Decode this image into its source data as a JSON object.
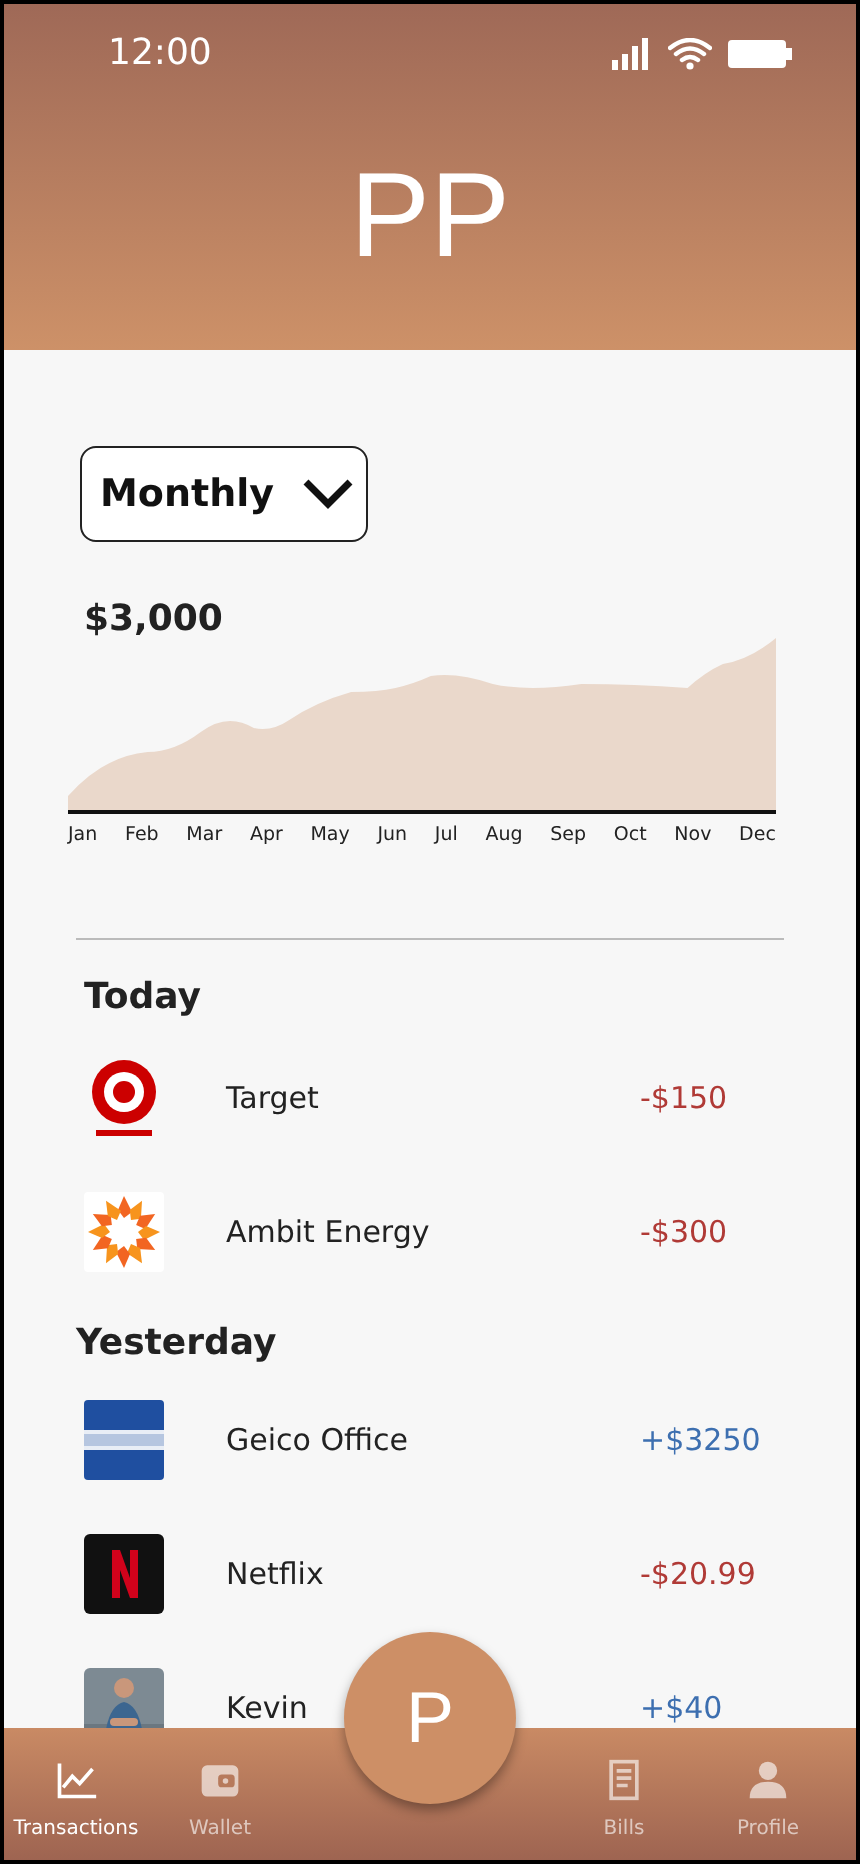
{
  "status_bar": {
    "time": "12:00"
  },
  "header": {
    "initials": "PP"
  },
  "period_select": {
    "value": "Monthly"
  },
  "chart": {
    "amount": "$3,000",
    "months": [
      "Jan",
      "Feb",
      "Mar",
      "Apr",
      "May",
      "Jun",
      "Jul",
      "Aug",
      "Sep",
      "Oct",
      "Nov",
      "Dec"
    ]
  },
  "groups": [
    {
      "title": "Today",
      "transactions": [
        {
          "name": "Target",
          "amount": "-$150",
          "kind": "debit"
        },
        {
          "name": "Ambit Energy",
          "amount": "-$300",
          "kind": "debit"
        }
      ]
    },
    {
      "title": "Yesterday",
      "transactions": [
        {
          "name": "Geico Office",
          "amount": "+$3250",
          "kind": "credit"
        },
        {
          "name": "Netflix",
          "amount": "-$20.99",
          "kind": "debit"
        },
        {
          "name": "Kevin",
          "amount": "+$40",
          "kind": "credit"
        }
      ]
    }
  ],
  "fab": {
    "label": "P"
  },
  "nav": [
    {
      "label": "Transactions",
      "selected": true
    },
    {
      "label": "Wallet",
      "selected": false
    },
    {
      "label": "Bills",
      "selected": false
    },
    {
      "label": "Profile",
      "selected": false
    }
  ]
}
